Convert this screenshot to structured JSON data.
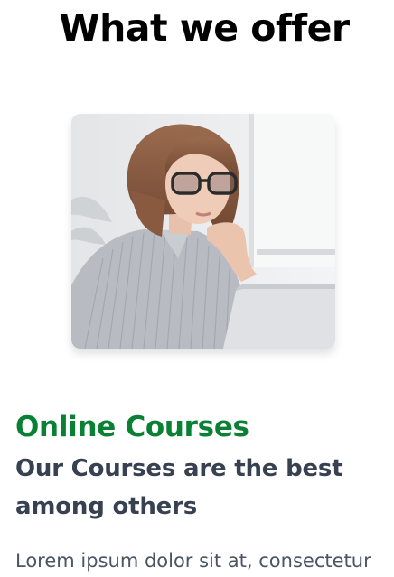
{
  "section": {
    "title": "What we offer"
  },
  "course": {
    "title": "Online Courses",
    "title_color": "#0a8035",
    "tagline": "Our Courses are the best among others",
    "description": "Lorem ipsum dolor sit at, consectetur",
    "image": "woman-with-glasses-laptop-photo"
  }
}
